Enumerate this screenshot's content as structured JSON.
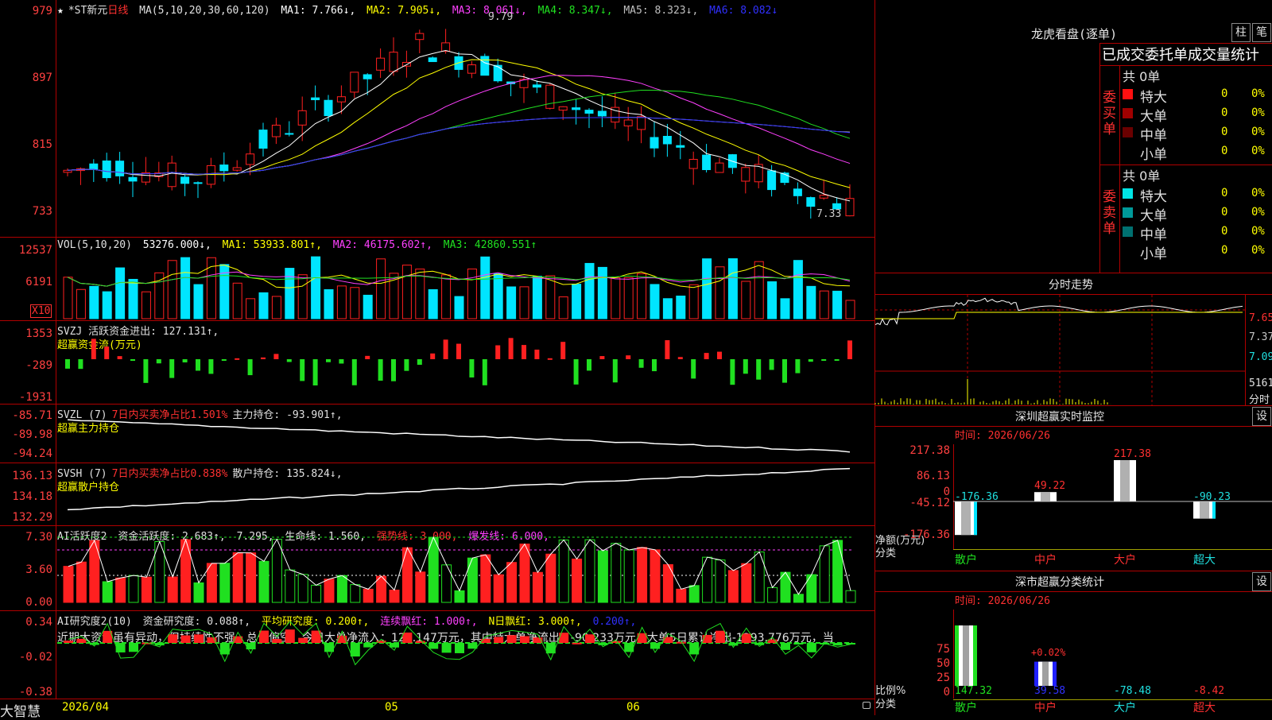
{
  "app": {
    "name": "大智慧"
  },
  "main": {
    "price_header": {
      "star": "★",
      "stock_name": "*ST新元",
      "period": "日线",
      "ma_label": "MA(5,10,20,30,60,120)",
      "ma1": "MA1: 7.766↓,",
      "ma2": "MA2: 7.905↓,",
      "ma3": "MA3: 8.061↓,",
      "ma4": "MA4: 8.347↓,",
      "ma5": "MA5: 8.323↓,",
      "ma6": "MA6: 8.082↓"
    },
    "price_axis": [
      "979",
      "897",
      "815",
      "733"
    ],
    "price_high_label": "9.79",
    "price_low_label": "7.33",
    "vol_header": {
      "label": "VOL(5,10,20)",
      "val": "53276.000↓,",
      "ma1": "MA1: 53933.801↑,",
      "ma2": "MA2: 46175.602↑,",
      "ma3": "MA3: 42860.551↑"
    },
    "vol_axis": [
      "12537",
      "6191"
    ],
    "vol_unit": "X10",
    "svzj_header": {
      "line1": "SVZJ  活跃资金进出: 127.131↑,",
      "line2": "超赢资金流(万元)"
    },
    "svzj_axis": [
      "1353",
      "-289",
      "-1931"
    ],
    "svzl_header": {
      "a": "SVZL (7)",
      "b": "7日内买卖净占比1.501%",
      "c": "主力持仓: -93.901↑,",
      "line2": "超赢主力持仓"
    },
    "svzl_axis": [
      "-85.71",
      "-89.98",
      "-94.24"
    ],
    "svsh_header": {
      "a": "SVSH (7)",
      "b": "7日内买卖净占比0.838%",
      "c": "散户持仓: 135.824↓,",
      "line2": "超赢散户持仓"
    },
    "svsh_axis": [
      "136.13",
      "134.18",
      "132.29"
    ],
    "ai1_header": {
      "a": "AI活跃度2",
      "b": "资金活跃度: 2.683↑,",
      "c": "7.295,",
      "d": "生命线: 1.560,",
      "e": "强势线: 3.000,",
      "f": "爆发线: 6.000,"
    },
    "ai1_axis": [
      "7.30",
      "3.60",
      "0.00"
    ],
    "ai2_header": {
      "a": "AI研究度2(10)",
      "b": "资金研究度: 0.088↑,",
      "c": "平均研究度: 0.200↑,",
      "d": "连续飘红: 1.000↑,",
      "e": "N日飘红: 3.000↑,",
      "f": "0.200↑,"
    },
    "ai2_text": "近期大资金虽有异动，但持续性不强，总体偏空，今日大单净流入：127.147万元，其中特大单净流出：-90.233万元，大单5日累计净出-1293.776万元，当",
    "ai2_axis": [
      "0.34",
      "-0.02",
      "-0.38"
    ],
    "date_axis": [
      "2026/04",
      "05",
      "06"
    ]
  },
  "right": {
    "dragon": {
      "title": "龙虎看盘(逐单)",
      "btn_col": "柱",
      "btn_pen": "笔",
      "subtitle": "已成交委托单成交量统计",
      "buy": {
        "side": "委买单",
        "total": "共 0单",
        "rows": [
          {
            "label": "特大",
            "count": "0",
            "pct": "0%",
            "color": "#ff1010"
          },
          {
            "label": "大单",
            "count": "0",
            "pct": "0%",
            "color": "#a00000"
          },
          {
            "label": "中单",
            "count": "0",
            "pct": "0%",
            "color": "#6a0000"
          },
          {
            "label": "小单",
            "count": "0",
            "pct": "0%",
            "color": ""
          }
        ]
      },
      "sell": {
        "side": "委卖单",
        "total": "共 0单",
        "rows": [
          {
            "label": "特大",
            "count": "0",
            "pct": "0%",
            "color": "#00e5e5"
          },
          {
            "label": "大单",
            "count": "0",
            "pct": "0%",
            "color": "#009a9a"
          },
          {
            "label": "中单",
            "count": "0",
            "pct": "0%",
            "color": "#007070"
          },
          {
            "label": "小单",
            "count": "0",
            "pct": "0%",
            "color": ""
          }
        ]
      }
    },
    "intraday": {
      "title": "分时走势",
      "axis": [
        "7.65",
        "7.37",
        "7.09",
        "5161"
      ],
      "unit": "分时"
    },
    "monitor": {
      "title": "深圳超赢实时监控",
      "set": "设",
      "time": "时间: 2026/06/26",
      "axis": [
        "217.38",
        "86.13",
        "0",
        "-45.12",
        "-176.36"
      ],
      "unit": "净额(万元)",
      "cat_label": "分类",
      "bars": [
        {
          "label": "散户",
          "value": -176.36,
          "value_text": "-176.36"
        },
        {
          "label": "中户",
          "value": 49.22,
          "value_text": "49.22"
        },
        {
          "label": "大户",
          "value": 217.38,
          "value_text": "217.38"
        },
        {
          "label": "超大",
          "value": -90.23,
          "value_text": "-90.23"
        }
      ]
    },
    "classify": {
      "title": "深市超赢分类统计",
      "set": "设",
      "time": "时间: 2026/06/26",
      "axis": [
        "75",
        "50",
        "25",
        "0"
      ],
      "unit": "比例%",
      "cat_label": "分类",
      "bar2_label": "+0.02%",
      "cats": [
        {
          "label": "散户",
          "value_text": "147.32",
          "pct": 100
        },
        {
          "label": "中户",
          "value_text": "39.58",
          "pct": 40
        },
        {
          "label": "大户",
          "value_text": "-78.48",
          "pct": 0
        },
        {
          "label": "超大",
          "value_text": "-8.42",
          "pct": 0
        }
      ]
    }
  }
}
